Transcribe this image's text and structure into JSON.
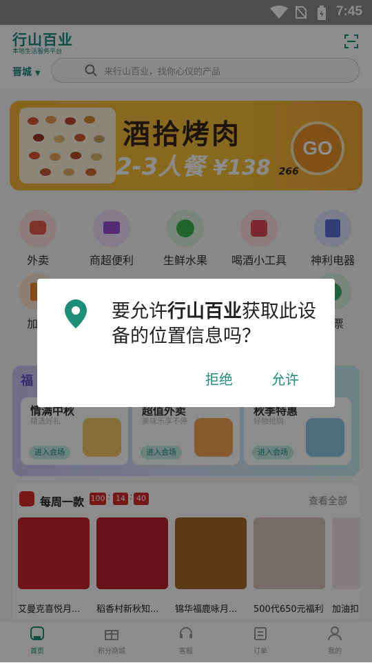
{
  "status_bar": {
    "time": "7:45",
    "icons": [
      "wifi-icon",
      "no-sim-icon",
      "battery-charging-icon"
    ]
  },
  "header": {
    "app_name": "行山百业",
    "tagline": "本地生活服务平台",
    "city": "晋城",
    "search_placeholder": "来行山百业，找你心仪的产品"
  },
  "banner": {
    "title": "酒拾烤肉",
    "subtitle": "2-3人餐",
    "price": "¥138",
    "original_price": "266",
    "go_label": "GO"
  },
  "categories": [
    {
      "label": "外卖",
      "icon": "delivery-scooter-icon",
      "color": "#e85a4f"
    },
    {
      "label": "商超便利",
      "icon": "shopping-cart-icon",
      "color": "#9b4fd6"
    },
    {
      "label": "生鲜水果",
      "icon": "apple-icon",
      "color": "#3fb34f"
    },
    {
      "label": "喝酒小工具",
      "icon": "dice-icon",
      "color": "#e04a5a"
    },
    {
      "label": "神利电器",
      "icon": "appliance-icon",
      "color": "#5b6fd6"
    },
    {
      "label": "加油",
      "icon": "fuel-icon",
      "color": "#f08a2a"
    },
    {
      "label": "影票",
      "icon": "movie-ticket-icon",
      "color": "#3fb36a"
    }
  ],
  "promo": {
    "title": "福",
    "cards": [
      {
        "title": "情满中秋",
        "subtitle": "精选好礼",
        "button": "进入会场"
      },
      {
        "title": "超值外卖",
        "subtitle": "美味乐享不停",
        "button": "进入会场"
      },
      {
        "title": "秋季特惠",
        "subtitle": "好物抢购",
        "button": "进入会场"
      }
    ]
  },
  "weekly": {
    "title": "每周一款",
    "countdown": [
      "100",
      "14",
      "40"
    ],
    "view_all": "查看全部",
    "products": [
      {
        "name": "艾曼克喜悦月...",
        "color": "#c6232b"
      },
      {
        "name": "稻香村新秋知...",
        "color": "#b8212e"
      },
      {
        "name": "锦华福鹿咏月...",
        "color": "#a86a2c"
      },
      {
        "name": "500代650元福利",
        "color": "#d9c3bd"
      },
      {
        "name": "加油扣",
        "color": "#e9e4e2"
      }
    ]
  },
  "tabbar": {
    "items": [
      {
        "label": "首页",
        "icon": "home-icon",
        "active": true
      },
      {
        "label": "积分商城",
        "icon": "gift-icon",
        "active": false
      },
      {
        "label": "客服",
        "icon": "headset-icon",
        "active": false
      },
      {
        "label": "订单",
        "icon": "order-list-icon",
        "active": false
      },
      {
        "label": "我的",
        "icon": "user-icon",
        "active": false
      }
    ]
  },
  "dialog": {
    "message_prefix": "要允许",
    "app_name": "行山百业",
    "message_suffix": "获取此设备的位置信息吗？",
    "deny": "拒绝",
    "allow": "允许",
    "accent": "#1d8c78"
  }
}
